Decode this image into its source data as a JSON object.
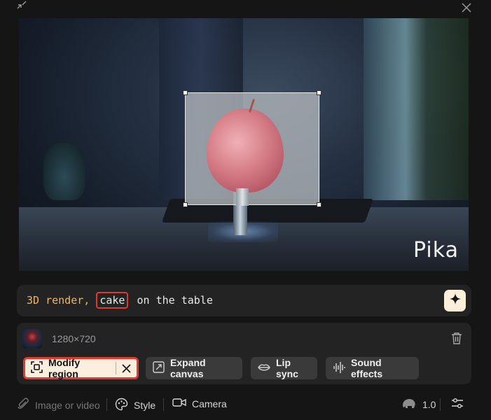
{
  "prompt": {
    "prefix": "3D render,",
    "highlight": "cake",
    "suffix": " on the table"
  },
  "preview": {
    "watermark": "Pika"
  },
  "media": {
    "resolution": "1280×720"
  },
  "actions": {
    "modify_region": "Modify region",
    "expand_canvas": "Expand canvas",
    "lip_sync": "Lip sync",
    "sound_effects": "Sound effects"
  },
  "toolbar": {
    "image_or_video": "Image or video",
    "style": "Style",
    "camera": "Camera",
    "motion_value": "1.0"
  },
  "colors": {
    "accent_red": "#e2382f",
    "accent_cream": "#fbeedd",
    "prompt_orange": "#f2b561"
  }
}
